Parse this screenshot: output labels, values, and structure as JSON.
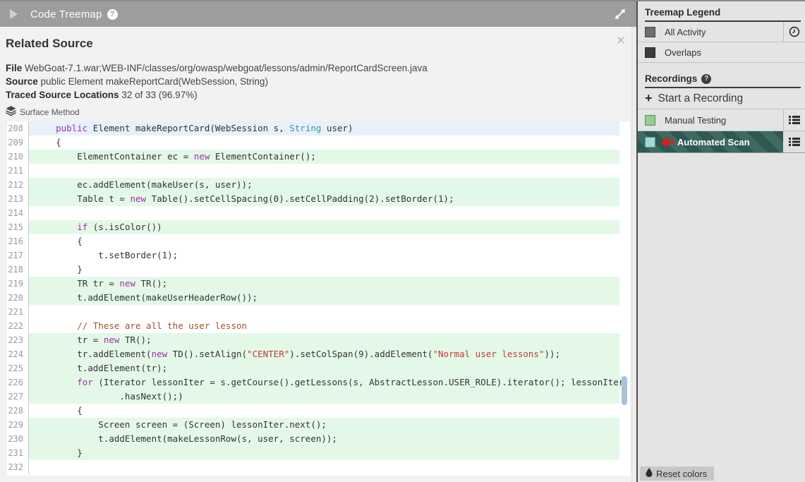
{
  "colors": {
    "topbar_bg": "#9d9d9d",
    "panel_bg": "#f2f2f2",
    "highlight_green": "#e4f8e7",
    "highlight_blue": "#e7f0fb",
    "keyword": "#a12fae",
    "type": "#2e9b8f",
    "string": "#c23b33",
    "comment": "#a0522d",
    "stripe_dark": "#2f5850",
    "stripe_light": "#3f6a61",
    "scroll_thumb": "#a9c2db"
  },
  "topbar": {
    "title": "Code Treemap",
    "help": "?"
  },
  "related_source": {
    "title": "Related Source",
    "close": "×",
    "file_label": "File",
    "file_value": "WebGoat-7.1.war;WEB-INF/classes/org/owasp/webgoat/lessons/admin/ReportCardScreen.java",
    "source_label": "Source",
    "source_value": "public Element makeReportCard(WebSession, String)",
    "traced_label": "Traced Source Locations",
    "traced_value": "32 of 33 (96.97%)",
    "surface_method": "Surface Method"
  },
  "code": {
    "lines": [
      {
        "n": 208,
        "hl": "blue",
        "tokens": [
          {
            "t": "pl",
            "v": "    "
          },
          {
            "t": "kw",
            "v": "public"
          },
          {
            "t": "pl",
            "v": " Element makeReportCard(WebSession s, "
          },
          {
            "t": "ty",
            "v": "String"
          },
          {
            "t": "pl",
            "v": " user)"
          }
        ]
      },
      {
        "n": 209,
        "hl": null,
        "tokens": [
          {
            "t": "pl",
            "v": "    {"
          }
        ]
      },
      {
        "n": 210,
        "hl": "green",
        "tokens": [
          {
            "t": "pl",
            "v": "        ElementContainer ec = "
          },
          {
            "t": "kw",
            "v": "new"
          },
          {
            "t": "pl",
            "v": " ElementContainer();"
          }
        ]
      },
      {
        "n": 211,
        "hl": null,
        "tokens": []
      },
      {
        "n": 212,
        "hl": "green",
        "tokens": [
          {
            "t": "pl",
            "v": "        ec.addElement(makeUser(s, user));"
          }
        ]
      },
      {
        "n": 213,
        "hl": "green",
        "tokens": [
          {
            "t": "pl",
            "v": "        Table t = "
          },
          {
            "t": "kw",
            "v": "new"
          },
          {
            "t": "pl",
            "v": " Table().setCellSpacing(0).setCellPadding(2).setBorder(1);"
          }
        ]
      },
      {
        "n": 214,
        "hl": null,
        "tokens": []
      },
      {
        "n": 215,
        "hl": "green",
        "tokens": [
          {
            "t": "pl",
            "v": "        "
          },
          {
            "t": "kw",
            "v": "if"
          },
          {
            "t": "pl",
            "v": " (s.isColor())"
          }
        ]
      },
      {
        "n": 216,
        "hl": null,
        "tokens": [
          {
            "t": "pl",
            "v": "        {"
          }
        ]
      },
      {
        "n": 217,
        "hl": null,
        "tokens": [
          {
            "t": "pl",
            "v": "            t.setBorder(1);"
          }
        ]
      },
      {
        "n": 218,
        "hl": null,
        "tokens": [
          {
            "t": "pl",
            "v": "        }"
          }
        ]
      },
      {
        "n": 219,
        "hl": "green",
        "tokens": [
          {
            "t": "pl",
            "v": "        TR tr = "
          },
          {
            "t": "kw",
            "v": "new"
          },
          {
            "t": "pl",
            "v": " TR();"
          }
        ]
      },
      {
        "n": 220,
        "hl": "green",
        "tokens": [
          {
            "t": "pl",
            "v": "        t.addElement(makeUserHeaderRow());"
          }
        ]
      },
      {
        "n": 221,
        "hl": null,
        "tokens": []
      },
      {
        "n": 222,
        "hl": null,
        "tokens": [
          {
            "t": "cm",
            "v": "        // These are all the user lesson"
          }
        ]
      },
      {
        "n": 223,
        "hl": "green",
        "tokens": [
          {
            "t": "pl",
            "v": "        tr = "
          },
          {
            "t": "kw",
            "v": "new"
          },
          {
            "t": "pl",
            "v": " TR();"
          }
        ]
      },
      {
        "n": 224,
        "hl": "green",
        "tokens": [
          {
            "t": "pl",
            "v": "        tr.addElement("
          },
          {
            "t": "kw",
            "v": "new"
          },
          {
            "t": "pl",
            "v": " TD().setAlign("
          },
          {
            "t": "st",
            "v": "\"CENTER\""
          },
          {
            "t": "pl",
            "v": ").setColSpan(9).addElement("
          },
          {
            "t": "st",
            "v": "\"Normal user lessons\""
          },
          {
            "t": "pl",
            "v": "));"
          }
        ]
      },
      {
        "n": 225,
        "hl": "green",
        "tokens": [
          {
            "t": "pl",
            "v": "        t.addElement(tr);"
          }
        ]
      },
      {
        "n": 226,
        "hl": "green",
        "tokens": [
          {
            "t": "pl",
            "v": "        "
          },
          {
            "t": "kw",
            "v": "for"
          },
          {
            "t": "pl",
            "v": " (Iterator lessonIter = s.getCourse().getLessons(s, AbstractLesson.USER_ROLE).iterator(); lessonIter"
          }
        ]
      },
      {
        "n": 227,
        "hl": "green",
        "tokens": [
          {
            "t": "pl",
            "v": "                .hasNext();)"
          }
        ]
      },
      {
        "n": 228,
        "hl": null,
        "tokens": [
          {
            "t": "pl",
            "v": "        {"
          }
        ]
      },
      {
        "n": 229,
        "hl": "green",
        "tokens": [
          {
            "t": "pl",
            "v": "            Screen screen = (Screen) lessonIter.next();"
          }
        ]
      },
      {
        "n": 230,
        "hl": "green",
        "tokens": [
          {
            "t": "pl",
            "v": "            t.addElement(makeLessonRow(s, user, screen));"
          }
        ]
      },
      {
        "n": 231,
        "hl": "green",
        "tokens": [
          {
            "t": "pl",
            "v": "        }"
          }
        ]
      },
      {
        "n": 232,
        "hl": null,
        "tokens": []
      }
    ]
  },
  "sidebar": {
    "legend": {
      "title": "Treemap Legend",
      "items": [
        {
          "label": "All Activity",
          "swatch": "#6e6e6e"
        },
        {
          "label": "Overlaps",
          "swatch": "#3c3c3c"
        }
      ]
    },
    "recordings": {
      "title": "Recordings",
      "help": "?",
      "start_label": "Start a Recording",
      "items": [
        {
          "label": "Manual Testing",
          "swatch": "#90d092"
        },
        {
          "label": "Automated Scan",
          "swatch": "#9fdcd8"
        }
      ]
    },
    "reset_label": "Reset colors"
  }
}
